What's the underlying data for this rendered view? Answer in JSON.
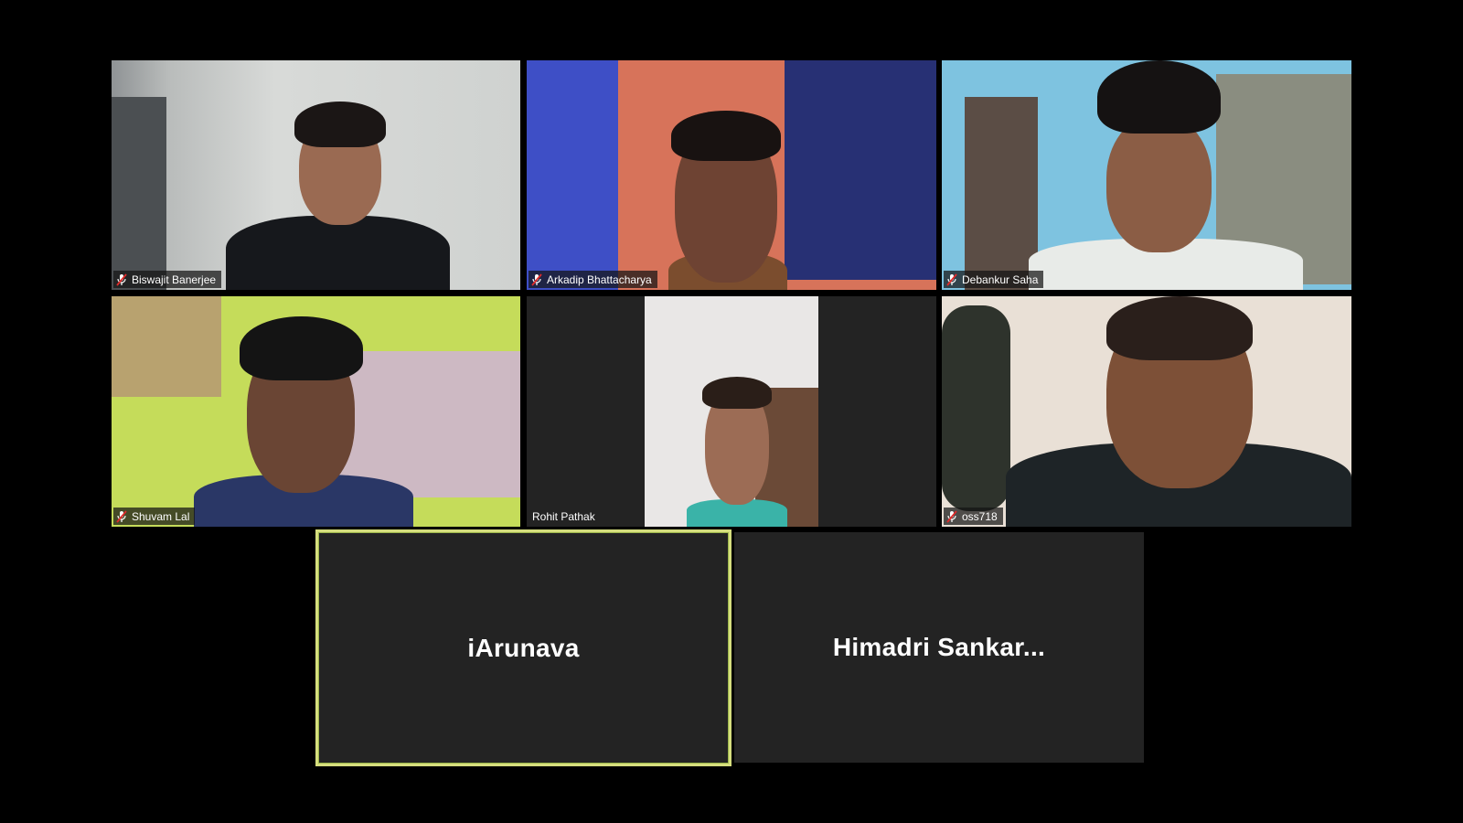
{
  "participants": [
    {
      "name": "Biswajit Banerjee",
      "muted": true,
      "video": true
    },
    {
      "name": "Arkadip Bhattacharya",
      "muted": true,
      "video": true
    },
    {
      "name": "Debankur Saha",
      "muted": true,
      "video": true
    },
    {
      "name": "Shuvam Lal",
      "muted": true,
      "video": true
    },
    {
      "name": "Rohit Pathak",
      "muted": false,
      "video": true
    },
    {
      "name": "oss718",
      "muted": true,
      "video": true
    },
    {
      "name": "iArunava",
      "video": false,
      "active_speaker": true
    },
    {
      "name": "Himadri  Sankar...",
      "video": false
    }
  ],
  "icons": {
    "muted_mic": "muted-mic-icon"
  },
  "colors": {
    "active_speaker_border": "#d6de7e",
    "mute_red": "#e02b2b",
    "tile_bg": "#232323"
  }
}
